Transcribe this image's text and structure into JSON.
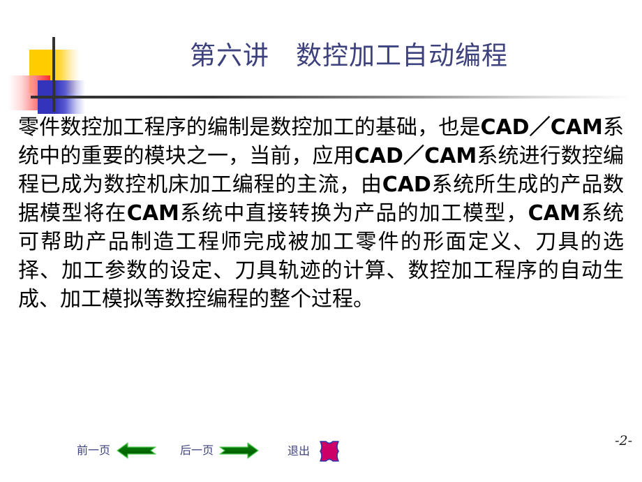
{
  "slide": {
    "title": "第六讲　数控加工自动编程",
    "page_number": "-2-",
    "title_color": "#3d417d",
    "body_color": "#000000",
    "accent_yellow": "#ffcc00",
    "accent_red": "#fb2d2d",
    "accent_blue": "#3333bb",
    "rule_color": "#333333"
  },
  "body": {
    "segments": [
      {
        "text": "零件数控加工程序的编制是数控加工的基础，也是",
        "bold": false
      },
      {
        "text": "CAD／CAM",
        "bold": true
      },
      {
        "text": "系统中的重要的模块之一，当前，应用",
        "bold": false
      },
      {
        "text": "CAD／CAM",
        "bold": true
      },
      {
        "text": "系统进行数控编程已成为数控机床加工编程的主流，由",
        "bold": false
      },
      {
        "text": "CAD",
        "bold": true
      },
      {
        "text": "系统所生成的产品数据模型将在",
        "bold": false
      },
      {
        "text": "CAM",
        "bold": true
      },
      {
        "text": "系统中直接转换为产品的加工模型，",
        "bold": false
      },
      {
        "text": "CAM",
        "bold": true
      },
      {
        "text": "系统可帮助产品制造工程师完成被加工零件的形面定义、刀具的选择、加工参数的设定、刀具轨迹的计算、数控加工程序的自动生成、加工模拟等数控编程的整个过程。",
        "bold": false
      }
    ]
  },
  "nav": {
    "prev": {
      "label": "前一页",
      "icon": "arrow-left-icon",
      "icon_color": "#007000"
    },
    "next": {
      "label": "后一页",
      "icon": "arrow-right-icon",
      "icon_color": "#007000"
    },
    "exit": {
      "label": "退出",
      "icon": "exit-octagon-icon",
      "icon_fill": "#cc0066",
      "icon_stroke": "#3333aa"
    }
  }
}
